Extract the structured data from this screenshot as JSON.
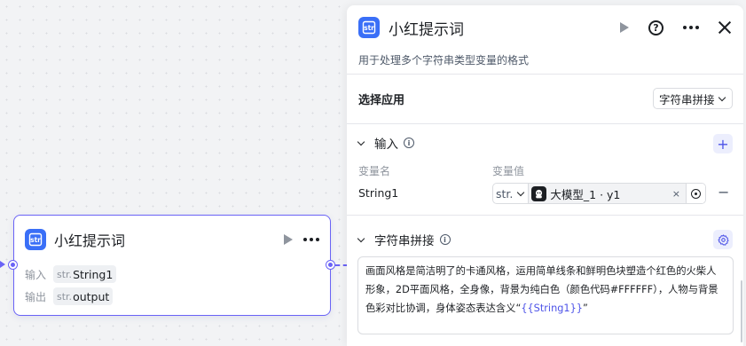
{
  "node": {
    "title": "小红提示词",
    "input_label": "输入",
    "output_label": "输出",
    "type_tag": "str.",
    "input_var": "String1",
    "output_var": "output"
  },
  "panel": {
    "title": "小红提示词",
    "description": "用于处理多个字符串类型变量的格式",
    "select_app_label": "选择应用",
    "select_app_value": "字符串拼接",
    "input_section": {
      "title": "输入",
      "col_name": "变量名",
      "col_value": "变量值",
      "var_name": "String1",
      "var_type": "str.",
      "var_ref": "大模型_1 · y1",
      "clear_glyph": "×",
      "remove_glyph": "−",
      "add_glyph": "+"
    },
    "concat_section": {
      "title": "字符串拼接",
      "text_before": "画面风格是简洁明了的卡通风格，运用简单线条和鲜明色块塑造个红色的火柴人形象，2D平面风格，全身像，背景为纯白色（颜色代码#FFFFFF），人物与背景色彩对比协调，身体姿态表达含义“",
      "template_var": "{{String1}}",
      "text_after": "”"
    }
  },
  "icons": {
    "node_icon": "string-icon",
    "accent": "#4d53e8",
    "node_icon_bg": "#3a6ff7",
    "node_border": "#6a63f6"
  }
}
